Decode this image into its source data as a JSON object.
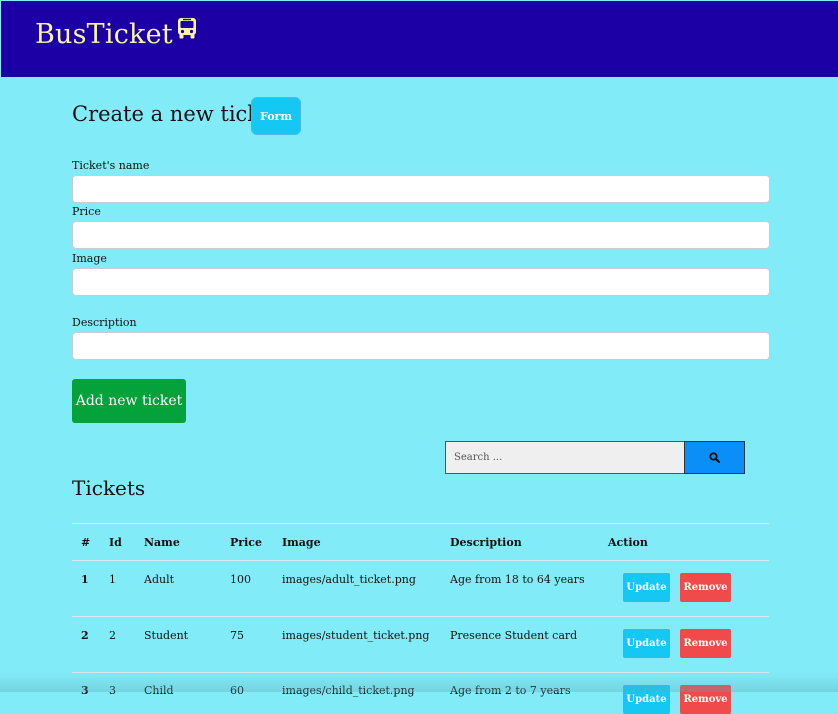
{
  "header": {
    "brand": "BusTicket",
    "brand_icon": "bus-icon",
    "brand_color": "#f7f5a9",
    "bar_color": "#1d00a5"
  },
  "form": {
    "title": "Create a new ticket",
    "badge": "Form",
    "fields": [
      {
        "label": "Ticket's name",
        "value": ""
      },
      {
        "label": "Price",
        "value": ""
      },
      {
        "label": "Image",
        "value": ""
      },
      {
        "label": "Description",
        "value": ""
      }
    ],
    "submit_label": "Add new ticket"
  },
  "search": {
    "placeholder": "Search ...",
    "icon": "search-icon"
  },
  "tickets": {
    "title": "Tickets",
    "columns": [
      "#",
      "Id",
      "Name",
      "Price",
      "Image",
      "Description",
      "Action"
    ],
    "rows": [
      {
        "num": "1",
        "id": "1",
        "name": "Adult",
        "price": "100",
        "image": "images/adult_ticket.png",
        "description": "Age from 18 to 64 years"
      },
      {
        "num": "2",
        "id": "2",
        "name": "Student",
        "price": "75",
        "image": "images/student_ticket.png",
        "description": "Presence Student card"
      },
      {
        "num": "3",
        "id": "3",
        "name": "Child",
        "price": "60",
        "image": "images/child_ticket.png",
        "description": "Age from 2 to 7 years"
      }
    ],
    "update_label": "Update",
    "remove_label": "Remove"
  },
  "colors": {
    "page_bg": "#82ebf8",
    "submit": "#03a23a",
    "update": "#14c8f3",
    "remove": "#f14a4a",
    "search_button": "#0a8ff8"
  }
}
